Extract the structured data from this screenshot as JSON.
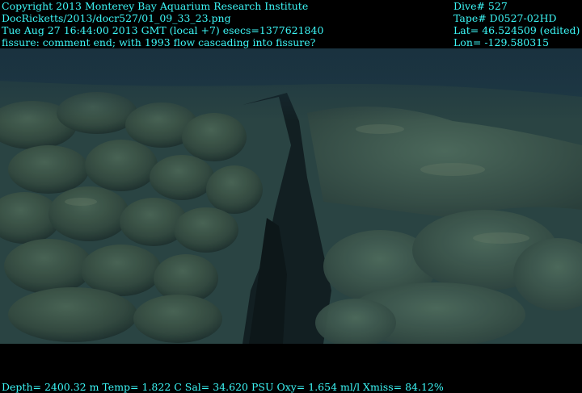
{
  "overlay": {
    "left_lines": [
      "Copyright 2013 Monterey Bay Aquarium Research Institute",
      "DocRicketts/2013/docr527/01_09_33_23.png",
      "Tue Aug 27 16:44:00 2013 GMT (local +7)  esecs=1377621840",
      "fissure: comment end; with 1993 flow cascading into fissure?"
    ],
    "right_lines": [
      "Dive# 527",
      "Tape# D0527-02HD",
      "Lat= 46.524509 (edited)",
      "Lon= -129.580315"
    ],
    "bottom_line": "Depth= 2400.32 m  Temp= 1.822 C  Sal= 34.620 PSU  Oxy= 1.654 ml/l  Xmiss= 84.12%"
  },
  "colors": {
    "overlay_text": "#3cf6f6",
    "letterbox": "#000000",
    "water": "#1b3340",
    "rock": "#3a5448",
    "fissure": "#121f22"
  }
}
